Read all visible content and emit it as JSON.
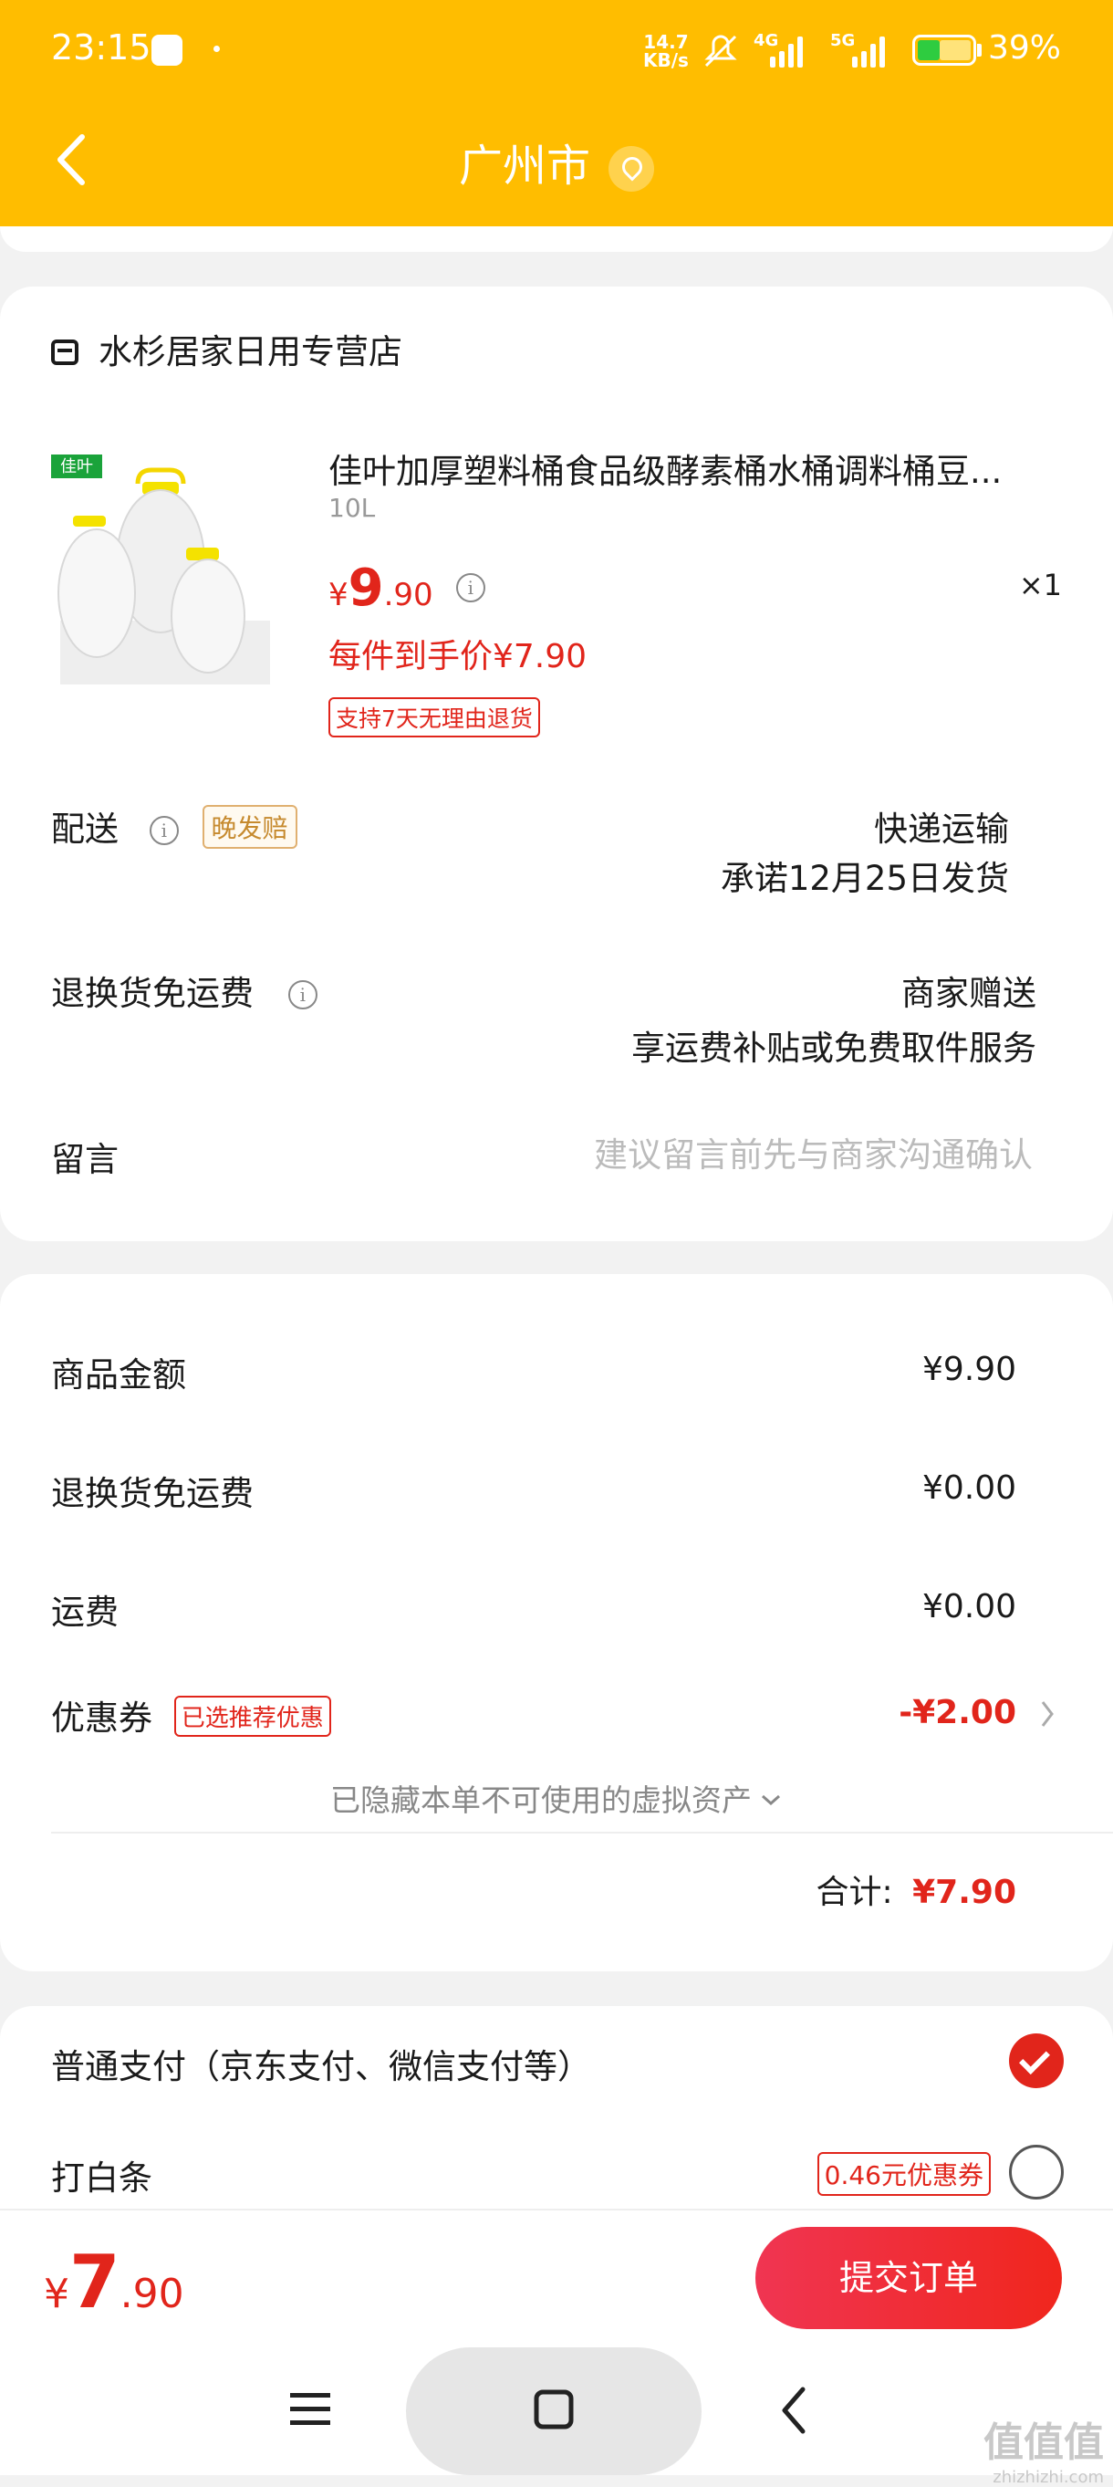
{
  "status_bar": {
    "time": "23:15",
    "net_speed": "14.7",
    "net_speed_unit": "KB/s",
    "net_4g": "4G",
    "net_5g": "5G",
    "battery": "39%"
  },
  "header": {
    "title": "广州市"
  },
  "store": {
    "name": "水杉居家日用专营店",
    "product": {
      "brand_badge": "佳叶",
      "name": "佳叶加厚塑料桶食品级酵素桶水桶调料桶豆...",
      "spec": "10L",
      "price_symbol": "¥",
      "price_int": "9",
      "price_dec": ".90",
      "quantity": "×1",
      "unit_price": "每件到手价¥7.90",
      "return_tag": "支持7天无理由退货"
    },
    "delivery": {
      "label": "配送",
      "late_tag": "晚发赔",
      "method": "快递运输",
      "promise": "承诺12月25日发货"
    },
    "return_shipping": {
      "label": "退换货免运费",
      "value": "商家赠送",
      "note": "享运费补贴或免费取件服务"
    },
    "message": {
      "label": "留言",
      "placeholder": "建议留言前先与商家沟通确认"
    }
  },
  "summary": {
    "items": [
      {
        "label": "商品金额",
        "value": "¥9.90"
      },
      {
        "label": "退换货免运费",
        "value": "¥0.00"
      },
      {
        "label": "运费",
        "value": "¥0.00"
      }
    ],
    "coupon": {
      "label": "优惠券",
      "tag": "已选推荐优惠",
      "value": "-¥2.00"
    },
    "hidden_assets": "已隐藏本单不可使用的虚拟资产",
    "total_label": "合计:",
    "total_value": "¥7.90"
  },
  "payment": {
    "option1": "普通支付（京东支付、微信支付等）",
    "option2": "打白条",
    "option2_tag": "0.46元优惠券"
  },
  "bottom_bar": {
    "price_symbol": "¥",
    "price_int": "7",
    "price_dec": ".90",
    "submit": "提交订单"
  },
  "watermark": {
    "text": "值值值",
    "domain": "zhizhizhi.com"
  },
  "colors": {
    "header": "#ffbd00",
    "accent_red": "#e1251b"
  }
}
